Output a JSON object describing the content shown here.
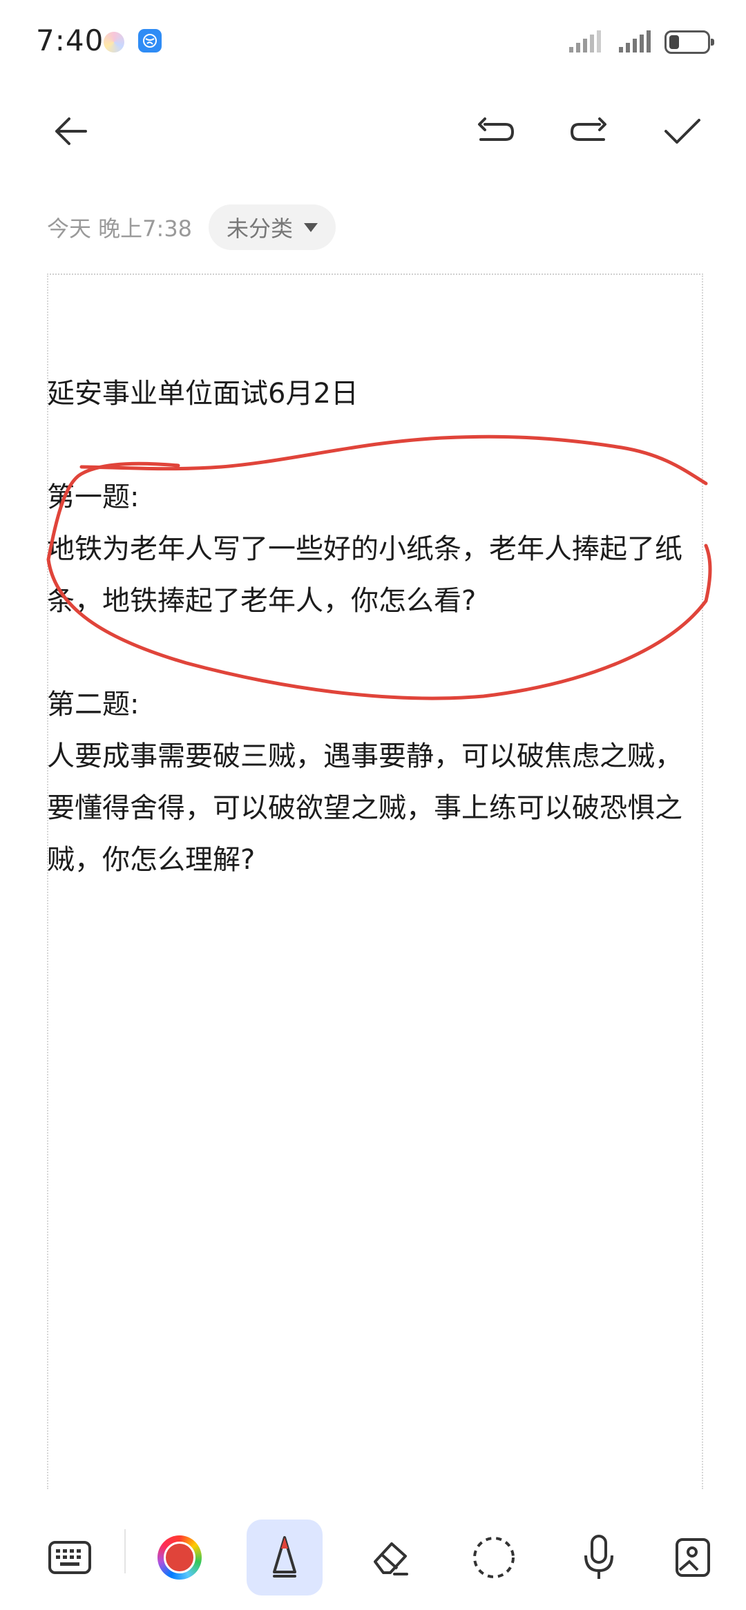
{
  "status_bar": {
    "time": "7:40",
    "icons": [
      "photos-icon",
      "browser-icon",
      "signal-icon",
      "signal-icon",
      "battery-icon"
    ],
    "battery_level": 0.25
  },
  "toolbar": {
    "back_icon": "back-arrow-icon",
    "undo_icon": "undo-icon",
    "redo_icon": "redo-icon",
    "done_icon": "checkmark-icon"
  },
  "meta": {
    "timestamp": "今天 晚上7:38",
    "category": "未分类"
  },
  "note": {
    "title": "延安事业单位面试6月2日",
    "q1_heading": "第一题:",
    "q1_text": "地铁为老年人写了一些好的小纸条，老年人捧起了纸条，地铁捧起了老年人，你怎么看?",
    "q2_heading": "第二题:",
    "q2_text": "人要成事需要破三贼，遇事要静，可以破焦虑之贼，要懂得舍得，可以破欲望之贼，事上练可以破恐惧之贼，你怎么理解?"
  },
  "annotation": {
    "ink_color": "#e0443a"
  },
  "bottom_tools": [
    {
      "name": "keyboard-icon"
    },
    {
      "name": "color-picker-icon"
    },
    {
      "name": "pen-icon",
      "active": true
    },
    {
      "name": "eraser-icon"
    },
    {
      "name": "lasso-select-icon"
    },
    {
      "name": "microphone-icon"
    },
    {
      "name": "image-icon"
    }
  ]
}
